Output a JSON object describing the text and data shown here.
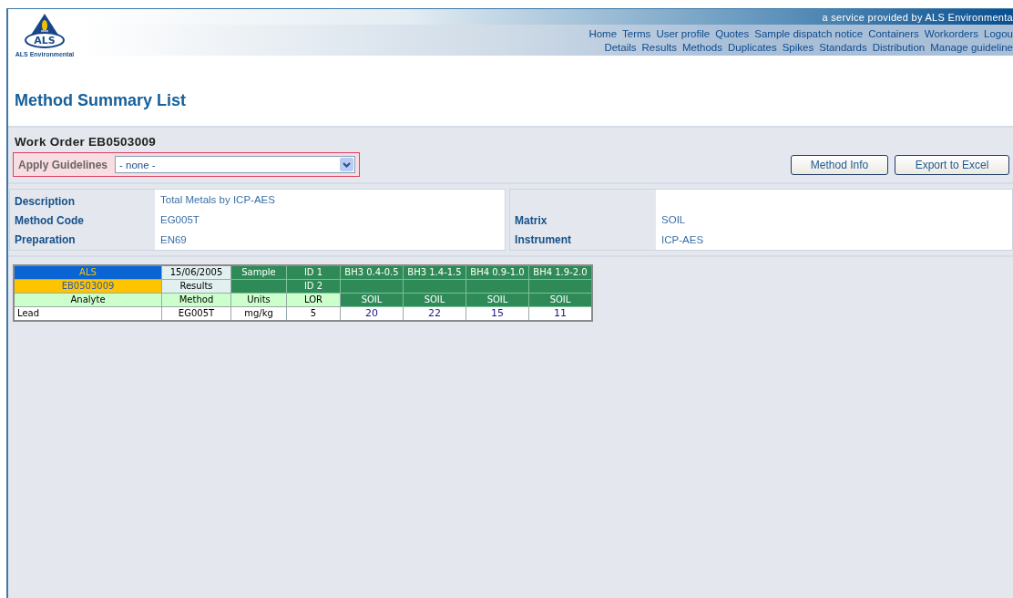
{
  "header": {
    "logo_mark": "ALS",
    "logo_caption": "ALS Environmental",
    "tagline": "a service provided by ALS Environmenta",
    "nav_rows": [
      [
        "Home",
        "Terms",
        "User profile",
        "Quotes",
        "Sample dispatch notice",
        "Containers",
        "Workorders",
        "Logou"
      ],
      [
        "Details",
        "Results",
        "Methods",
        "Duplicates",
        "Spikes",
        "Standards",
        "Distribution",
        "Manage guideline"
      ]
    ]
  },
  "title": "Method Summary List",
  "work_order": {
    "title": "Work Order EB0503009",
    "guidelines_label": "Apply Guidelines",
    "guidelines_value": "- none -",
    "buttons": [
      "Method Info",
      "Export to Excel"
    ]
  },
  "details": {
    "left": [
      {
        "label": "Description",
        "value": "Total Metals by ICP-AES"
      },
      {
        "label": "Method Code",
        "value": "EG005T"
      },
      {
        "label": "Preparation",
        "value": "EN69"
      }
    ],
    "right": [
      {
        "label": "Matrix",
        "value": "SOIL"
      },
      {
        "label": "Instrument",
        "value": "ICP-AES"
      }
    ]
  },
  "results": {
    "rows": [
      [
        {
          "text": "ALS",
          "kind": "brand"
        },
        {
          "text": "15/06/2005",
          "kind": "pale"
        },
        {
          "text": "Sample",
          "kind": "header"
        },
        {
          "text": "ID 1",
          "kind": "header"
        },
        {
          "text": "BH3 0.4-0.5",
          "kind": "header"
        },
        {
          "text": "BH3 1.4-1.5",
          "kind": "header"
        },
        {
          "text": "BH4 0.9-1.0",
          "kind": "header"
        },
        {
          "text": "BH4 1.9-2.0",
          "kind": "header"
        }
      ],
      [
        {
          "text": "EB0503009",
          "kind": "order"
        },
        {
          "text": "Results",
          "kind": "pale"
        },
        {
          "kind": "header"
        },
        {
          "text": "ID 2",
          "kind": "header"
        },
        {
          "kind": "header"
        },
        {
          "kind": "header"
        },
        {
          "kind": "header"
        },
        {
          "kind": "header"
        }
      ],
      [
        {
          "text": "Analyte",
          "kind": "caption"
        },
        {
          "text": "Method",
          "kind": "caption"
        },
        {
          "text": "Units",
          "kind": "caption"
        },
        {
          "text": "LOR",
          "kind": "caption"
        },
        {
          "text": "SOIL",
          "kind": "header"
        },
        {
          "text": "SOIL",
          "kind": "header"
        },
        {
          "text": "SOIL",
          "kind": "header"
        },
        {
          "text": "SOIL",
          "kind": "header"
        }
      ],
      [
        {
          "text": "Lead",
          "kind": "name"
        },
        {
          "text": "EG005T",
          "kind": "plain"
        },
        {
          "text": "mg/kg",
          "kind": "plain"
        },
        {
          "text": "5",
          "kind": "plain"
        },
        {
          "text": "20",
          "kind": "value"
        },
        {
          "text": "22",
          "kind": "value"
        },
        {
          "text": "15",
          "kind": "value"
        },
        {
          "text": "11",
          "kind": "value"
        }
      ]
    ]
  }
}
